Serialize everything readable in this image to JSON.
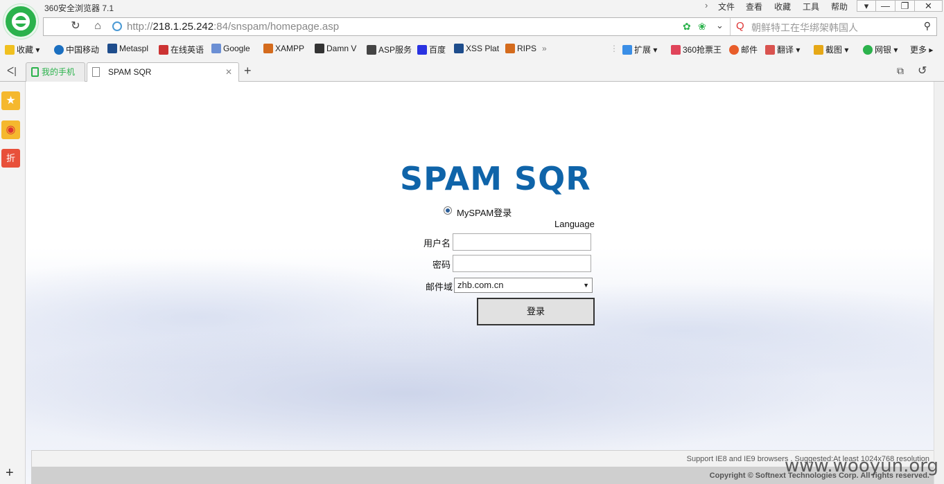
{
  "window": {
    "title": "360安全浏览器 7.1"
  },
  "menu": [
    "文件",
    "查看",
    "收藏",
    "工具",
    "帮助"
  ],
  "address": {
    "scheme": "http://",
    "host": "218.1.25.242",
    "rest": ":84/snspam/homepage.asp"
  },
  "search": {
    "placeholder": "朝鲜特工在华绑架韩国人"
  },
  "bookmarks_left": [
    "收藏",
    "中国移动",
    "Metaspl",
    "在线英语",
    "Google",
    "XAMPP",
    "Damn V",
    "ASP服务",
    "百度",
    "XSS Plat",
    "RIPS"
  ],
  "bookmarks_right": [
    "扩展",
    "360抢票王",
    "邮件",
    "翻译",
    "截图",
    "网银",
    "更多"
  ],
  "tabs": [
    {
      "label": "我的手机"
    },
    {
      "label": "SPAM SQR"
    }
  ],
  "page": {
    "brand": "SPAM SQR",
    "radio_label": "MySPAM登录",
    "language": "Language",
    "username_label": "用户名",
    "password_label": "密码",
    "domain_label": "邮件域",
    "domain_value": "zhb.com.cn",
    "login_label": "登录",
    "support_text": "Support IE8 and IE9 browsers . Suggested:At least 1024x768 resolution",
    "copyright": "Copyright © Softnext Technologies Corp. All rights reserved."
  },
  "watermark": "www.wooyun.org",
  "colors": {
    "brand": "#0f64a9",
    "browser_green": "#2bb24c"
  }
}
